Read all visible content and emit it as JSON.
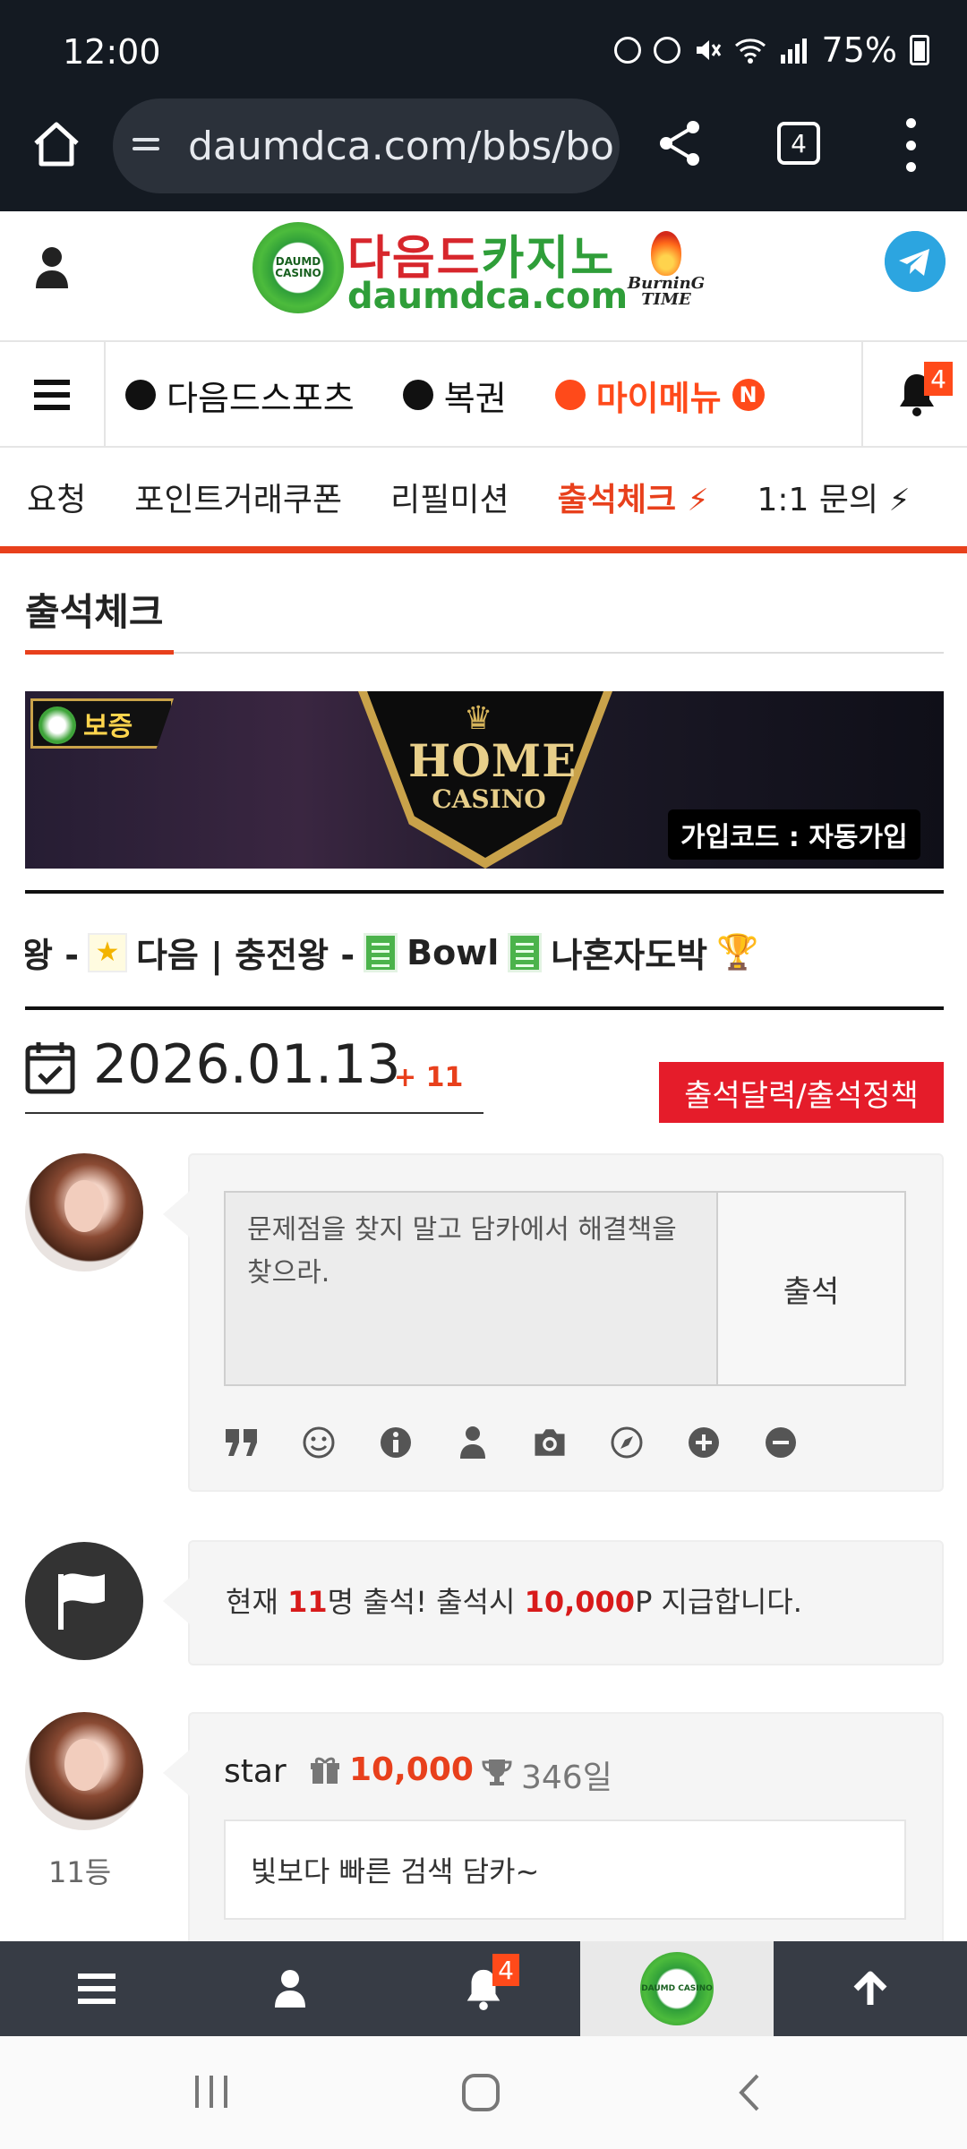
{
  "status": {
    "time": "12:00",
    "battery": "75%"
  },
  "browser": {
    "url": "daumdca.com/bbs/bo",
    "tab_count": "4"
  },
  "header": {
    "logo_badge": "DAUMD CASINO",
    "logo_kor_a": "다음드",
    "logo_kor_b": "카지노",
    "logo_domain": "daumdca.com",
    "burning_line1": "BurninG",
    "burning_line2": "TIME"
  },
  "nav": {
    "items": [
      "다음드스포츠",
      "복권"
    ],
    "mymenu": "마이메뉴",
    "mymenu_badge": "N",
    "bell_count": "4"
  },
  "submenu": {
    "items": [
      "요청",
      "포인트거래쿠폰",
      "리필미션"
    ],
    "active": "출석체크",
    "last": "1:1 문의"
  },
  "page": {
    "title": "출석체크"
  },
  "banner": {
    "badge": "보증",
    "brand_top": "HOME",
    "brand_bottom": "CASINO",
    "join_code": "가입코드 : 자동가입"
  },
  "marquee": {
    "p1": "왕 - ",
    "p2": "다음 | 충전왕 - ",
    "p3": "Bowl",
    "p4": "나혼자도박"
  },
  "date": {
    "value": "2026.01.13",
    "plus": "+ 11",
    "policy_button": "출석달력/출석정책"
  },
  "form": {
    "textarea_value": "문제점을 찾지 말고 담카에서 해결책을 찾으라.",
    "submit": "출석"
  },
  "info": {
    "prefix": "현재 ",
    "count": "11",
    "mid": "명 출석! 출석시 ",
    "amount": "10,000",
    "suffix": "P 지급합니다."
  },
  "entry": {
    "user": "star",
    "points": "10,000",
    "days": "346일",
    "rank": "11등",
    "comment": "빛보다 빠른 검색 담카~"
  },
  "bottom_nav": {
    "bell_count": "4",
    "logo": "DAUMD CASINO"
  }
}
